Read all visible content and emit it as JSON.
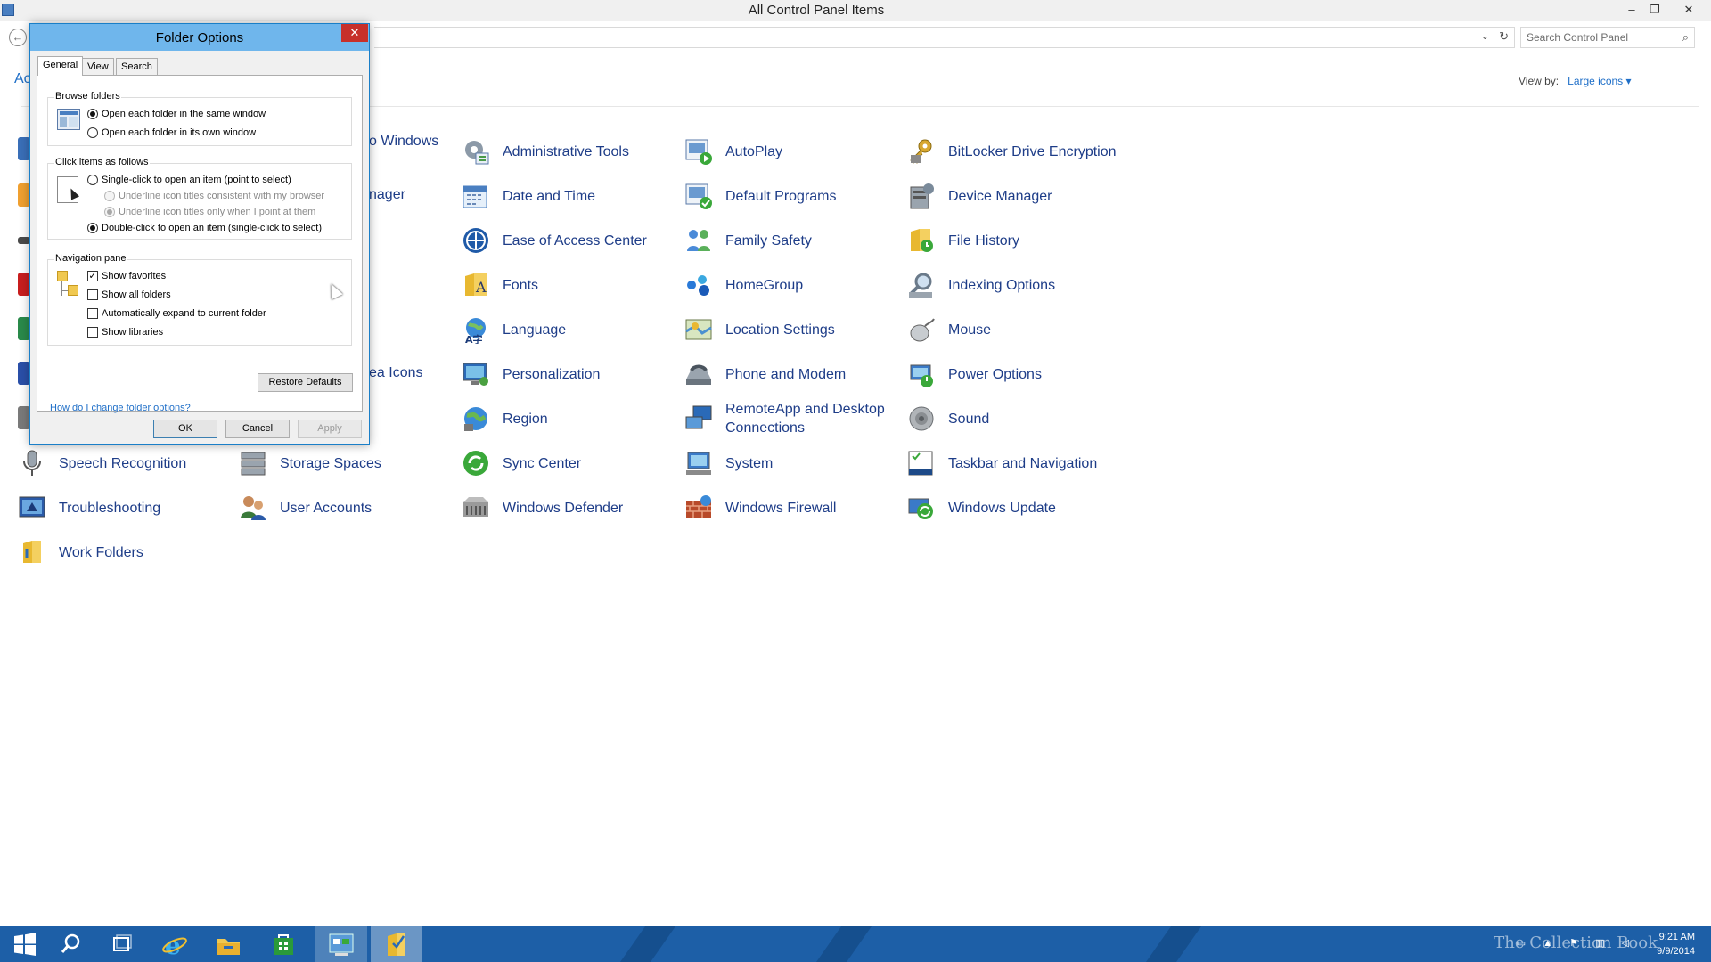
{
  "window": {
    "title": "All Control Panel Items",
    "minimize": "–",
    "restore": "❐",
    "close": "✕"
  },
  "address": {
    "back": "←",
    "dropdown": "⌄",
    "refresh": "↻"
  },
  "search": {
    "placeholder": "Search Control Panel"
  },
  "view_by": {
    "label": "View by:",
    "value": "Large icons ▾"
  },
  "left_partial": "Ac",
  "partials": {
    "windows": "o Windows",
    "manager": "nager",
    "area_icons": "ea Icons"
  },
  "items": {
    "administrative_tools": "Administrative Tools",
    "autoplay": "AutoPlay",
    "bitlocker": "BitLocker Drive Encryption",
    "date_time": "Date and Time",
    "default_programs": "Default Programs",
    "device_manager": "Device Manager",
    "ease_of_access": "Ease of Access Center",
    "family_safety": "Family Safety",
    "file_history": "File History",
    "fonts": "Fonts",
    "homegroup": "HomeGroup",
    "indexing_options": "Indexing Options",
    "language": "Language",
    "location_settings": "Location Settings",
    "mouse": "Mouse",
    "personalization": "Personalization",
    "phone_modem": "Phone and Modem",
    "power_options": "Power Options",
    "region": "Region",
    "remoteapp": "RemoteApp and Desktop Connections",
    "sound": "Sound",
    "speech_recognition": "Speech Recognition",
    "storage_spaces": "Storage Spaces",
    "sync_center": "Sync Center",
    "system": "System",
    "taskbar_navigation": "Taskbar and Navigation",
    "troubleshooting": "Troubleshooting",
    "user_accounts": "User Accounts",
    "windows_defender": "Windows Defender",
    "windows_firewall": "Windows Firewall",
    "windows_update": "Windows Update",
    "work_folders": "Work Folders"
  },
  "dialog": {
    "title": "Folder Options",
    "close": "✕",
    "tabs": {
      "general": "General",
      "view": "View",
      "search": "Search"
    },
    "browse_folders": {
      "label": "Browse folders",
      "same_window": "Open each folder in the same window",
      "own_window": "Open each folder in its own window"
    },
    "click_items": {
      "label": "Click items as follows",
      "single_click": "Single-click to open an item (point to select)",
      "underline_browser": "Underline icon titles consistent with my browser",
      "underline_point": "Underline icon titles only when I point at them",
      "double_click": "Double-click to open an item (single-click to select)"
    },
    "navigation_pane": {
      "label": "Navigation pane",
      "show_favorites": "Show favorites",
      "show_all_folders": "Show all folders",
      "auto_expand": "Automatically expand to current folder",
      "show_libraries": "Show libraries"
    },
    "restore_defaults": "Restore Defaults",
    "help_link": "How do I change folder options?",
    "ok": "OK",
    "cancel": "Cancel",
    "apply": "Apply"
  },
  "taskbar": {
    "watermark": "The Collection Book",
    "time": "9:21 AM",
    "date": "9/9/2014"
  }
}
